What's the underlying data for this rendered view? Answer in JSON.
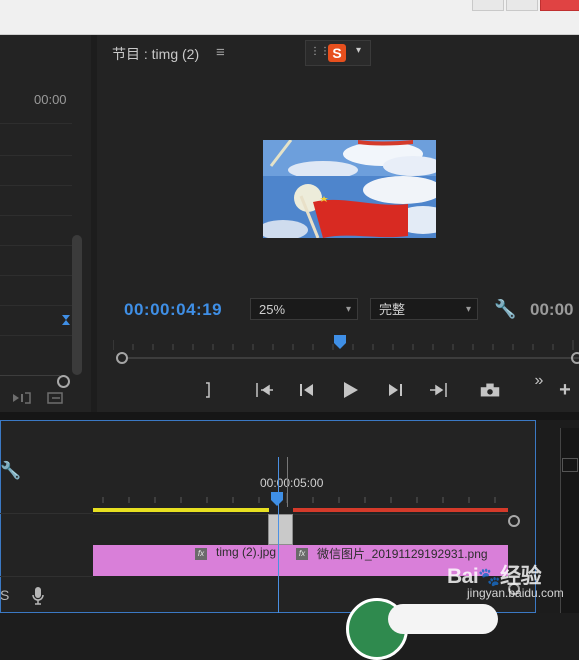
{
  "source_panel": {
    "timecode": "00:00"
  },
  "program_monitor": {
    "title": "节目 : timg (2)",
    "menu_icon": "hamburger-icon",
    "timecode": "00:00:04:19",
    "zoom": "25%",
    "quality": "完整",
    "timecode_right": "00:00",
    "controls": [
      "mark-in-icon",
      "go-to-in-icon",
      "step-back-icon",
      "play-icon",
      "step-forward-icon",
      "go-to-out-icon",
      "export-frame-icon",
      "more-icon",
      "add-icon"
    ]
  },
  "ime_toolbar": {
    "logo": "S"
  },
  "timeline": {
    "timecode": "00:00:05:00",
    "track_label": "S",
    "clips": [
      {
        "name": "timg (2).jpg",
        "fx": "fx"
      },
      {
        "name": "微信图片_20191129192931.png",
        "fx": "fx"
      }
    ]
  },
  "watermark": {
    "brand": "Bai",
    "brand_suffix": "经验",
    "url": "jingyan.baidu.com"
  },
  "colors": {
    "accent_blue": "#3f8fe6",
    "clip_pink": "#d97fd9",
    "render_yellow": "#e7e021",
    "render_red": "#d43a2a"
  }
}
